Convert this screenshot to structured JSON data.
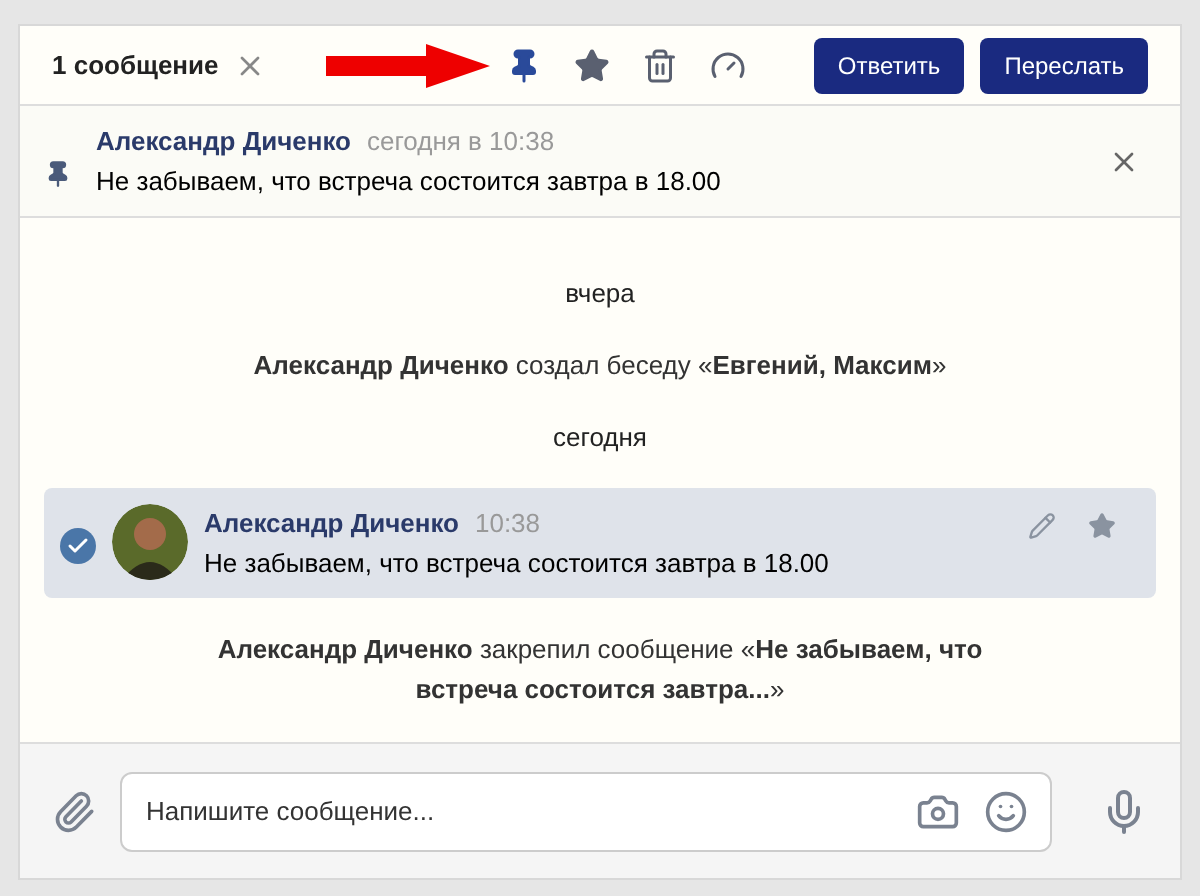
{
  "header": {
    "selection_count": "1 сообщение",
    "buttons": [
      "Ответить",
      "Переслать"
    ]
  },
  "annotation": {
    "kind": "arrow"
  },
  "pinned": {
    "author": "Александр Диченко",
    "time": "сегодня в 10:38",
    "text": "Не забываем, что встреча состоится завтра в 18.00"
  },
  "feed": [
    {
      "kind": "date",
      "text": "вчера"
    },
    {
      "kind": "service",
      "text": "**Александр Диченко** создал беседу «**Евгений, Максим**»"
    },
    {
      "kind": "date",
      "text": "сегодня"
    },
    {
      "kind": "message",
      "author": "Александр Диченко",
      "time": "10:38",
      "text": "Не забываем, что встреча состоится завтра в 18.00",
      "selected": true
    },
    {
      "kind": "service",
      "text": "**Александр Диченко** закрепил сообщение «**Не забываем, что встреча состоится завтра...**»"
    }
  ],
  "composer": {
    "placeholder": "Напишите сообщение..."
  }
}
